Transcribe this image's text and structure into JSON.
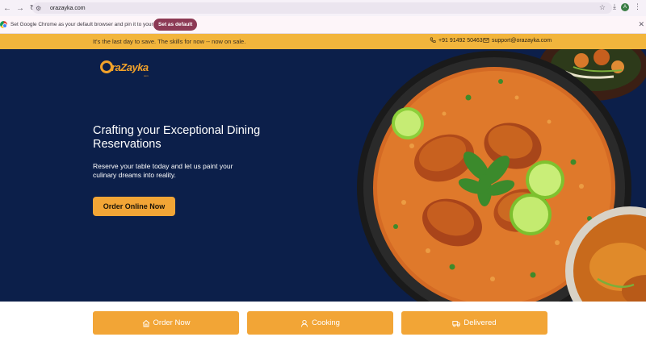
{
  "browser": {
    "url": "orazayka.com",
    "avatar_letter": "A"
  },
  "infobar": {
    "message": "Set Google Chrome as your default browser and pin it to your taskbar",
    "button_label": "Set as default"
  },
  "promo": {
    "text": "It's the last day to save. The skills for now -- now on sale.",
    "phone": "+91 91492 50463",
    "email": "support@orazayka.com"
  },
  "brand": {
    "name": "OraZayka",
    "tagline": "com",
    "accent": "#f2a536",
    "navy": "#0c1f4a"
  },
  "hero": {
    "headline": "Crafting your Exceptional Dining Reservations",
    "subline": "Reserve your table today and let us paint your culinary dreams into reality.",
    "cta_label": "Order Online Now"
  },
  "features": [
    {
      "label": "Order Now",
      "icon": "home-icon"
    },
    {
      "label": "Cooking",
      "icon": "chef-icon"
    },
    {
      "label": "Delivered",
      "icon": "truck-icon"
    }
  ]
}
